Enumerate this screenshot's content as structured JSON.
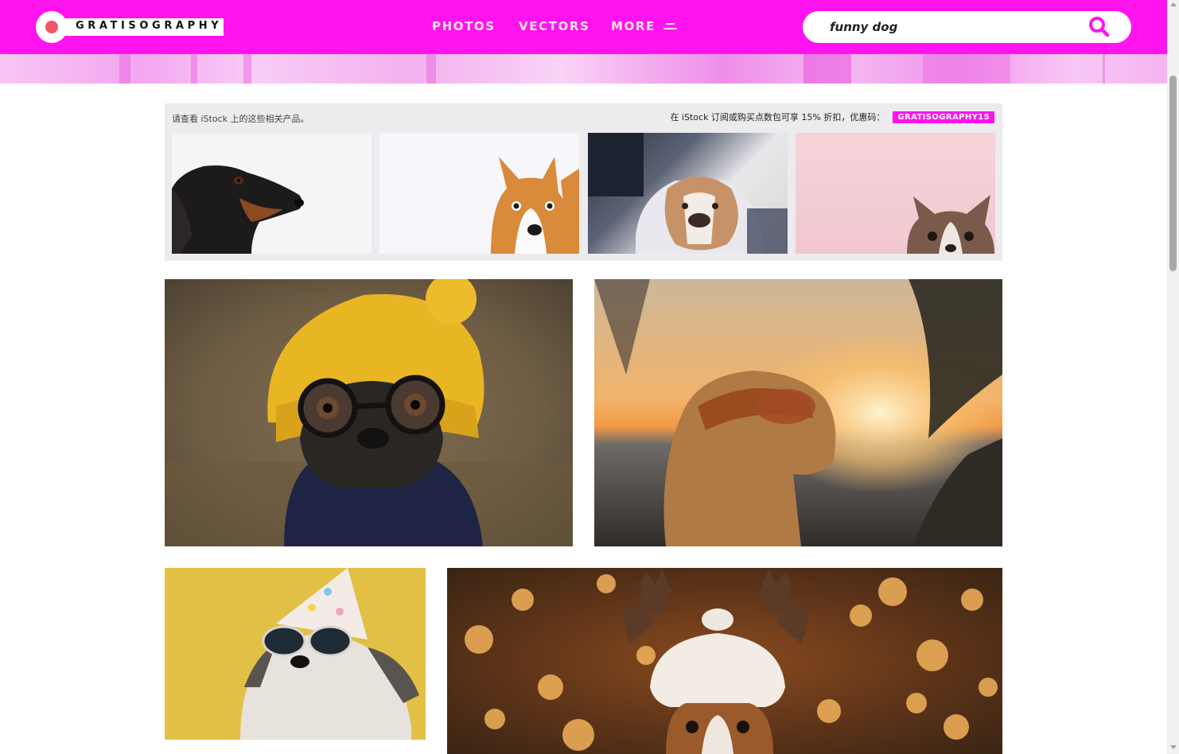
{
  "header": {
    "logo_text": "GRATISOGRAPHY",
    "brand_color": "#ff14f0",
    "nav": {
      "photos": "PHOTOS",
      "vectors": "VECTORS",
      "more": "MORE"
    },
    "search": {
      "value": "funny dog",
      "icon": "search-icon"
    }
  },
  "istock": {
    "left_text": "请查看 iStock 上的这些相关产品。",
    "offer_text": "在 iStock 订阅或购买点数包可享 15% 折扣，优惠码：",
    "code": "GRATISOGRAPHY15",
    "thumbnails": [
      {
        "subject": "dachshund"
      },
      {
        "subject": "corgi"
      },
      {
        "subject": "bulldog"
      },
      {
        "subject": "chihuahua"
      }
    ]
  },
  "photos": [
    {
      "subject": "pug with yellow beanie and glasses"
    },
    {
      "subject": "dog with sunglasses at sunset"
    },
    {
      "subject": "dog with party hat and sunglasses"
    },
    {
      "subject": "puppy with reindeer antlers"
    }
  ]
}
